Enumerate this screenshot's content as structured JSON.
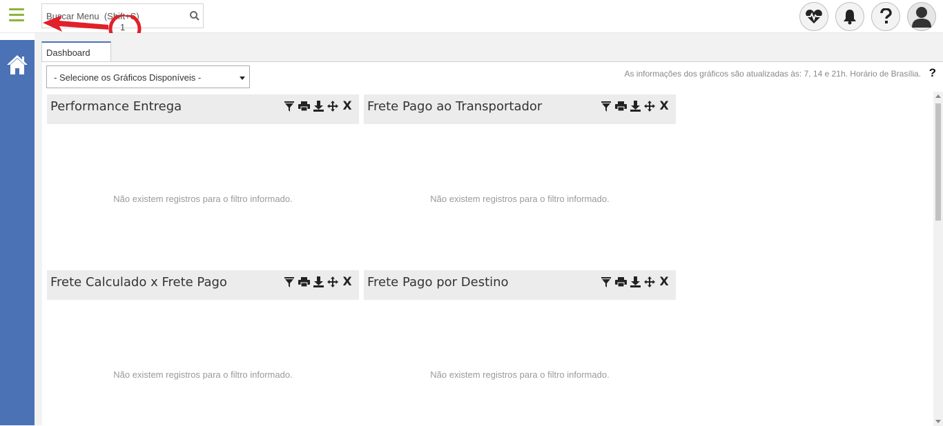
{
  "header": {
    "search_placeholder": "Buscar Menu  (Shift+S)",
    "icons": [
      "heart-pulse-icon",
      "bell-icon",
      "question-icon",
      "user-avatar-icon"
    ]
  },
  "annotation": {
    "label": "1"
  },
  "sidebar": {
    "home_icon": "home-icon"
  },
  "tabs": [
    {
      "label": "Dashboard"
    }
  ],
  "toolbar": {
    "select_value": "- Selecione os Gráficos Disponíveis -",
    "info_text": "As informações dos gráficos são atualizadas às: 7, 14 e 21h. Horário de Brasília.",
    "help_label": "?"
  },
  "widgets": [
    {
      "title": "Performance Entrega",
      "message": "Não existem registros para o filtro informado."
    },
    {
      "title": "Frete Pago ao Transportador",
      "message": "Não existem registros para o filtro informado."
    },
    {
      "title": "Frete Calculado x Frete Pago",
      "message": "Não existem registros para o filtro informado."
    },
    {
      "title": "Frete Pago por Destino",
      "message": "Não existem registros para o filtro informado."
    }
  ],
  "widget_tools": {
    "close_label": "X"
  },
  "colors": {
    "sidebar": "#4a72b5",
    "hamburger": "#8fb33a",
    "annotation": "#e0202a"
  }
}
